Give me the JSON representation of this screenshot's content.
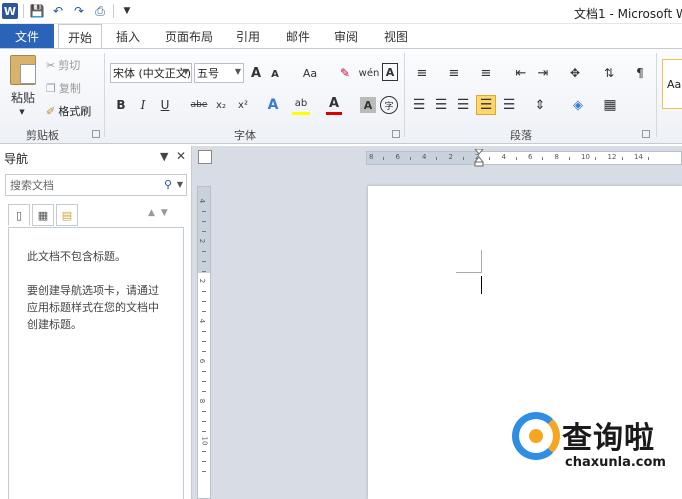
{
  "window": {
    "title": "文档1 - Microsoft W"
  },
  "quick_access": [
    "word-icon",
    "save-icon",
    "undo-icon",
    "redo-icon",
    "print-preview-icon",
    "customize-icon"
  ],
  "tabs": [
    {
      "label": "文件"
    },
    {
      "label": "开始"
    },
    {
      "label": "插入"
    },
    {
      "label": "页面布局"
    },
    {
      "label": "引用"
    },
    {
      "label": "邮件"
    },
    {
      "label": "审阅"
    },
    {
      "label": "视图"
    }
  ],
  "ribbon": {
    "clipboard": {
      "label": "剪贴板",
      "paste": "粘贴",
      "cut": "剪切",
      "copy": "复制",
      "format_painter": "格式刷"
    },
    "font": {
      "label": "字体",
      "font_name": "宋体 (中文正文)",
      "font_size": "五号",
      "grow": "A",
      "shrink": "A",
      "case": "Aa",
      "bold": "B",
      "italic": "I",
      "underline": "U",
      "strikethrough": "abe",
      "subscript": "x₂",
      "superscript": "x²",
      "char_border": "A",
      "phonetic": "wén",
      "enclose": "字"
    },
    "paragraph": {
      "label": "段落"
    },
    "styles": {
      "preview": "Aa"
    }
  },
  "navigation": {
    "title": "导航",
    "search_placeholder": "搜索文档",
    "empty_message": "此文档不包含标题。",
    "hint_line1": "要创建导航选项卡，请通过",
    "hint_line2": "应用标题样式在您的文档中",
    "hint_line3": "创建标题。"
  },
  "rulers": {
    "horizontal": [
      "8",
      "6",
      "4",
      "2",
      "2",
      "4",
      "6",
      "8",
      "10",
      "12",
      "14"
    ],
    "vertical": [
      "4",
      "2",
      "2",
      "4",
      "6",
      "8",
      "10"
    ]
  },
  "watermark": {
    "brand": "查询啦",
    "domain": "chaxunla.com"
  },
  "colors": {
    "file_tab": "#2b63b8",
    "accent": "#2b579a",
    "highlight": "#ffd66b"
  }
}
